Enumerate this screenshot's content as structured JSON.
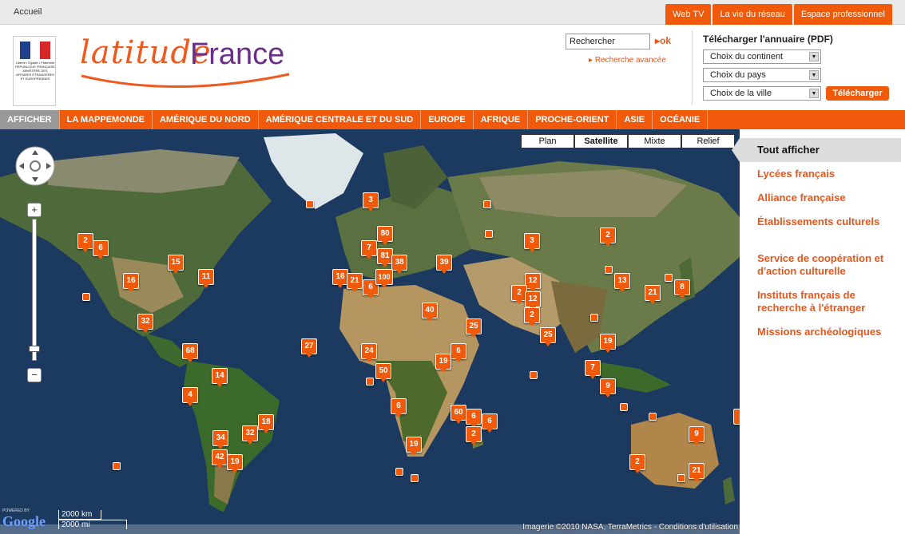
{
  "topbar": {
    "home": "Accueil",
    "tabs": [
      "Web TV",
      "La vie du réseau",
      "Espace professionnel"
    ]
  },
  "header": {
    "gov_logo_text": "Liberté • Égalité • Fraternité RÉPUBLIQUE FRANÇAISE MINISTÈRE DES AFFAIRES ÉTRANGÈRES ET EUROPÉENNES",
    "brand_part1": "latitude",
    "brand_part2": "France",
    "search_placeholder": "Rechercher",
    "search_ok": "ok",
    "advanced_search": "Recherche avancée",
    "download_title": "Télécharger l'annuaire (PDF)",
    "select_continent": "Choix du continent",
    "select_country": "Choix du pays",
    "select_city": "Choix de la ville",
    "download_button": "Télécharger"
  },
  "nav": {
    "items": [
      "AFFICHER",
      "LA MAPPEMONDE",
      "AMÉRIQUE DU NORD",
      "AMÉRIQUE CENTRALE ET DU SUD",
      "EUROPE",
      "AFRIQUE",
      "PROCHE-ORIENT",
      "ASIE",
      "OCÉANIE"
    ]
  },
  "map": {
    "types": [
      "Plan",
      "Satellite",
      "Mixte",
      "Relief"
    ],
    "active_type": "Satellite",
    "google_powered": "POWERED BY",
    "google_logo": "Google",
    "scale_km": "2000 km",
    "scale_mi": "2000 mi",
    "copyright": "Imagerie ©2010 NASA, TerraMetrics - Conditions d'utilisation",
    "markers": [
      "3",
      "80",
      "7",
      "81",
      "38",
      "39",
      "3",
      "2",
      "2",
      "6",
      "15",
      "11",
      "16",
      "16",
      "21",
      "6",
      "100",
      "12",
      "13",
      "8",
      "2",
      "12",
      "21",
      "40",
      "2",
      "25",
      "32",
      "25",
      "19",
      "27",
      "24",
      "6",
      "68",
      "19",
      "50",
      "14",
      "7",
      "9",
      "4",
      "6",
      "60",
      "6",
      "6",
      "2",
      "9",
      "18",
      "34",
      "32",
      "42",
      "19",
      "19",
      "2",
      "21"
    ]
  },
  "sidebar": {
    "categories": [
      "Tout afficher",
      "Lycées français",
      "Alliance française",
      "Établissements culturels",
      "Service de coopération et d'action culturelle",
      "Instituts français de recherche à l'étranger",
      "Missions archéologiques"
    ]
  }
}
